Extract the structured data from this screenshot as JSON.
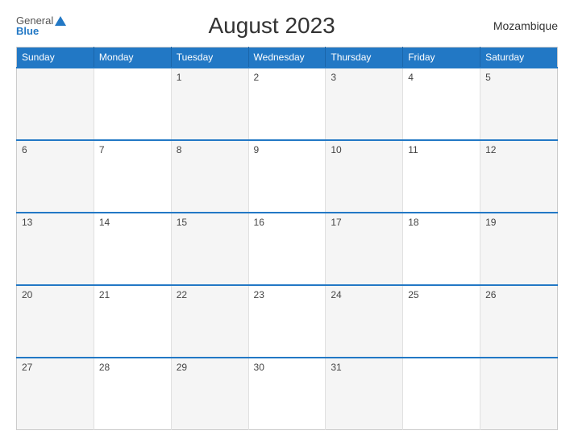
{
  "header": {
    "logo_general": "General",
    "logo_blue": "Blue",
    "title": "August 2023",
    "country": "Mozambique"
  },
  "weekdays": [
    "Sunday",
    "Monday",
    "Tuesday",
    "Wednesday",
    "Thursday",
    "Friday",
    "Saturday"
  ],
  "weeks": [
    [
      "",
      "",
      "1",
      "2",
      "3",
      "4",
      "5"
    ],
    [
      "6",
      "7",
      "8",
      "9",
      "10",
      "11",
      "12"
    ],
    [
      "13",
      "14",
      "15",
      "16",
      "17",
      "18",
      "19"
    ],
    [
      "20",
      "21",
      "22",
      "23",
      "24",
      "25",
      "26"
    ],
    [
      "27",
      "28",
      "29",
      "30",
      "31",
      "",
      ""
    ]
  ]
}
